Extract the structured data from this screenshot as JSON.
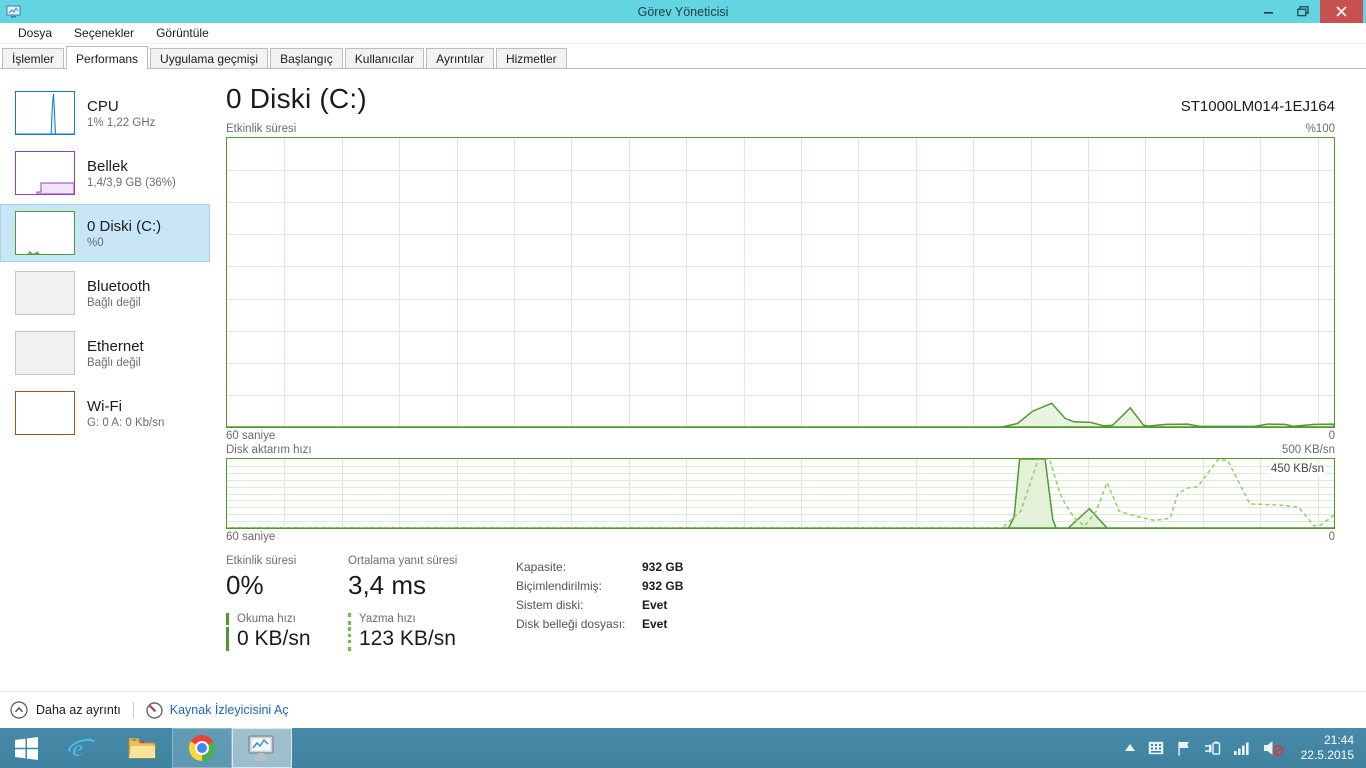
{
  "window": {
    "title": "Görev Yöneticisi"
  },
  "menu_bar": {
    "items": [
      {
        "label": "Dosya"
      },
      {
        "label": "Seçenekler"
      },
      {
        "label": "Görüntüle"
      }
    ]
  },
  "tab_bar": {
    "tabs": [
      {
        "label": "İşlemler"
      },
      {
        "label": "Performans"
      },
      {
        "label": "Uygulama geçmişi"
      },
      {
        "label": "Başlangıç"
      },
      {
        "label": "Kullanıcılar"
      },
      {
        "label": "Ayrıntılar"
      },
      {
        "label": "Hizmetler"
      }
    ]
  },
  "sidebar": {
    "items": [
      {
        "title": "CPU",
        "subtitle": "1% 1,22 GHz",
        "accent": "#1177d7",
        "state": "normal"
      },
      {
        "title": "Bellek",
        "subtitle": "1,4/3,9 GB (36%)",
        "accent": "#9541bf",
        "state": "normal"
      },
      {
        "title": "0 Diski (C:)",
        "subtitle": "%0",
        "accent": "#4e9a2e",
        "state": "selected"
      },
      {
        "title": "Bluetooth",
        "subtitle": "Bağlı değil",
        "accent": "#c6c6c6",
        "state": "disabled"
      },
      {
        "title": "Ethernet",
        "subtitle": "Bağlı değil",
        "accent": "#c6c6c6",
        "state": "disabled"
      },
      {
        "title": "Wi-Fi",
        "subtitle": "G: 0 A: 0 Kb/sn",
        "accent": "#99541d",
        "state": "normal"
      }
    ]
  },
  "main": {
    "page_title": "0 Diski (C:)",
    "device_model": "ST1000LM014-1EJ164",
    "activity_chart": {
      "title": "Etkinlik süresi",
      "y_max_label": "%100",
      "x_left_label": "60 saniye",
      "x_right_label": "0"
    },
    "transfer_chart": {
      "title": "Disk aktarım hızı",
      "y_max_label": "500 KB/sn",
      "scale_label": "450 KB/sn",
      "x_left_label": "60 saniye",
      "x_right_label": "0"
    },
    "stats": {
      "active_time": {
        "label": "Etkinlik süresi",
        "value": "0%"
      },
      "avg_response": {
        "label": "Ortalama yanıt süresi",
        "value": "3,4 ms"
      },
      "read_speed": {
        "label": "Okuma hızı",
        "value": "0 KB/sn"
      },
      "write_speed": {
        "label": "Yazma hızı",
        "value": "123 KB/sn"
      },
      "details": [
        {
          "label": "Kapasite:",
          "value": "932 GB"
        },
        {
          "label": "Biçimlendirilmiş:",
          "value": "932 GB"
        },
        {
          "label": "Sistem diski:",
          "value": "Evet"
        },
        {
          "label": "Disk belleği dosyası:",
          "value": "Evet"
        }
      ]
    }
  },
  "footer": {
    "collapse_label": "Daha az ayrıntı",
    "resource_link_label": "Kaynak İzleyicisini Aç"
  },
  "taskbar": {
    "time": "21:44",
    "date": "22.5.2015",
    "buttons": [
      "start",
      "internet-explorer",
      "file-explorer",
      "chrome",
      "task-manager"
    ],
    "tray_icons": [
      "show-hidden-chevron",
      "touch-keyboard",
      "action-center-flag",
      "power-plug",
      "network-signal",
      "volume-muted"
    ]
  },
  "chart_data": [
    {
      "type": "area",
      "name": "disk-active-time",
      "title": "Etkinlik süresi",
      "ylim": [
        0,
        100
      ],
      "unit": "%",
      "x_range_seconds": 60,
      "grid": "on",
      "series": [
        {
          "name": "active-time-percent",
          "style": "solid-filled",
          "color": "#4e9a2e",
          "fill": "#eaf3df",
          "points": [
            [
              0,
              0
            ],
            [
              0.7,
              0
            ],
            [
              0.714,
              1.2
            ],
            [
              0.728,
              5.5
            ],
            [
              0.745,
              8.2
            ],
            [
              0.757,
              3.0
            ],
            [
              0.765,
              1.8
            ],
            [
              0.78,
              1.6
            ],
            [
              0.792,
              0.4
            ],
            [
              0.8,
              0.6
            ],
            [
              0.816,
              6.6
            ],
            [
              0.828,
              0.6
            ],
            [
              0.832,
              0.3
            ],
            [
              0.848,
              0.9
            ],
            [
              0.868,
              1.0
            ],
            [
              0.878,
              0.2
            ],
            [
              0.928,
              0.2
            ],
            [
              0.94,
              1.0
            ],
            [
              0.956,
              0.9
            ],
            [
              0.963,
              0.2
            ],
            [
              0.982,
              0.9
            ],
            [
              1,
              1.0
            ]
          ]
        }
      ]
    },
    {
      "type": "area",
      "name": "disk-transfer-rate",
      "title": "Disk aktarım hızı",
      "ylim": [
        0,
        500
      ],
      "unit": "KB/sn",
      "x_range_seconds": 60,
      "grid": "on",
      "series": [
        {
          "name": "read-speed",
          "style": "solid-filled",
          "color": "#4e9a2e",
          "fill": "#e4f0d8",
          "points": [
            [
              0,
              0
            ],
            [
              0.706,
              0
            ],
            [
              0.711,
              80
            ],
            [
              0.716,
              500
            ],
            [
              0.739,
              500
            ],
            [
              0.746,
              60
            ],
            [
              0.749,
              0
            ],
            [
              0.76,
              0
            ],
            [
              0.779,
              140
            ],
            [
              0.795,
              0
            ],
            [
              1,
              0
            ]
          ]
        },
        {
          "name": "write-speed",
          "style": "dashed",
          "color": "#94cd68",
          "points": [
            [
              0,
              0
            ],
            [
              0.7,
              0
            ],
            [
              0.717,
              120
            ],
            [
              0.733,
              500
            ],
            [
              0.743,
              500
            ],
            [
              0.752,
              260
            ],
            [
              0.758,
              160
            ],
            [
              0.767,
              60
            ],
            [
              0.775,
              15
            ],
            [
              0.785,
              120
            ],
            [
              0.795,
              330
            ],
            [
              0.806,
              120
            ],
            [
              0.824,
              80
            ],
            [
              0.838,
              55
            ],
            [
              0.852,
              70
            ],
            [
              0.859,
              250
            ],
            [
              0.868,
              290
            ],
            [
              0.877,
              300
            ],
            [
              0.895,
              495
            ],
            [
              0.904,
              490
            ],
            [
              0.924,
              175
            ],
            [
              0.953,
              165
            ],
            [
              0.968,
              150
            ],
            [
              0.982,
              15
            ],
            [
              0.988,
              20
            ],
            [
              1,
              95
            ]
          ]
        }
      ]
    }
  ]
}
